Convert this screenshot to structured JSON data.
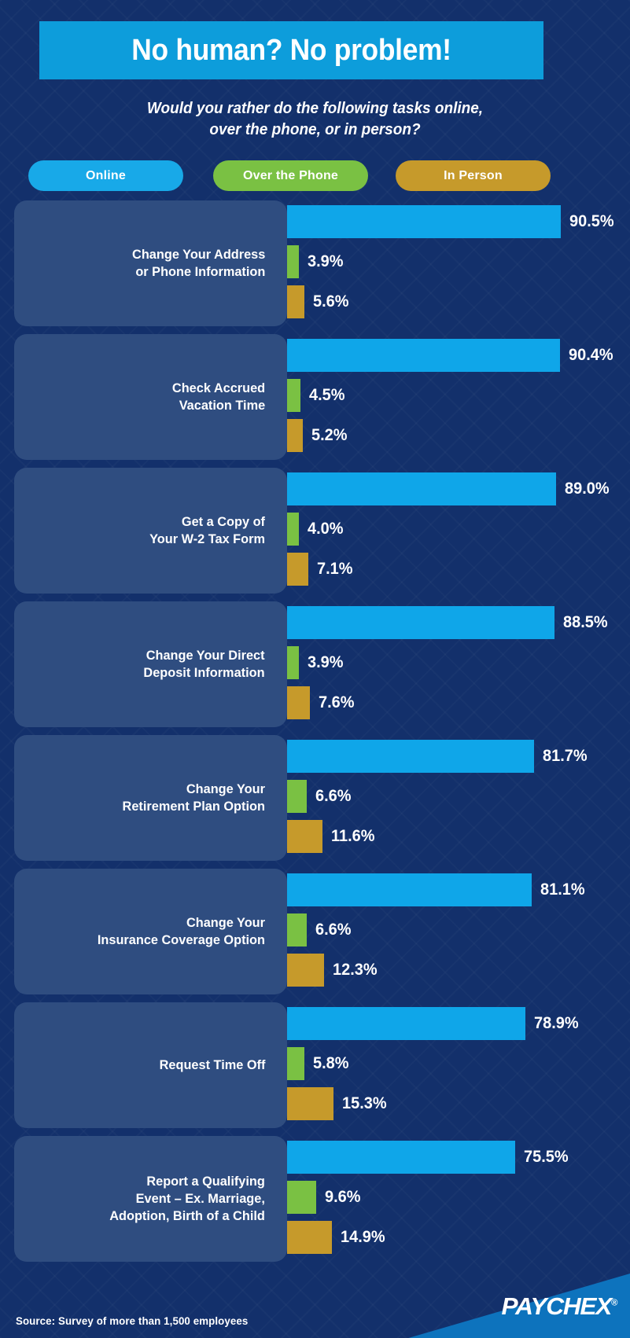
{
  "header": {
    "title": "No human? No problem!",
    "subtitle_line1": "Would you rather do the following tasks online,",
    "subtitle_line2": "over the phone, or in person?"
  },
  "legend": {
    "online": "Online",
    "phone": "Over the Phone",
    "person": "In Person"
  },
  "colors": {
    "background": "#13306b",
    "panel": "#2f4d80",
    "online": "#0fa6e9",
    "phone": "#7ac143",
    "person": "#c69a2b",
    "banner": "#0d9ddb",
    "footer_wedge": "#0d73bd",
    "text": "#ffffff"
  },
  "footer": {
    "source": "Source: Survey of more than 1,500 employees",
    "logo": "PAYCHEX",
    "logo_mark": "®"
  },
  "chart_data": {
    "type": "bar",
    "title": "No human? No problem!",
    "subtitle": "Would you rather do the following tasks online, over the phone, or in person?",
    "orientation": "horizontal",
    "xlabel": "",
    "ylabel": "",
    "xlim": [
      0,
      100
    ],
    "grid": false,
    "legend_position": "top",
    "value_suffix": "%",
    "categories": [
      "Change Your Address or Phone Information",
      "Check Accrued Vacation Time",
      "Get a Copy of Your W-2 Tax Form",
      "Change Your Direct Deposit Information",
      "Change Your Retirement Plan Option",
      "Change Your Insurance Coverage Option",
      "Request Time Off",
      "Report a Qualifying Event – Ex. Marriage, Adoption, Birth of a Child"
    ],
    "series": [
      {
        "name": "Online",
        "color": "#0fa6e9",
        "values": [
          90.5,
          90.4,
          89.0,
          88.5,
          81.7,
          81.1,
          78.9,
          75.5
        ]
      },
      {
        "name": "Over the Phone",
        "color": "#7ac143",
        "values": [
          3.9,
          4.5,
          4.0,
          3.9,
          6.6,
          6.6,
          5.8,
          9.6
        ]
      },
      {
        "name": "In Person",
        "color": "#c69a2b",
        "values": [
          5.6,
          5.2,
          7.1,
          7.6,
          11.6,
          12.3,
          15.3,
          14.9
        ]
      }
    ]
  },
  "rows": [
    {
      "label_lines": [
        "Change Your Address",
        "or Phone Information"
      ],
      "online": "90.5%",
      "phone": "3.9%",
      "person": "5.6%",
      "online_v": 90.5,
      "phone_v": 3.9,
      "person_v": 5.6
    },
    {
      "label_lines": [
        "Check Accrued",
        "Vacation Time"
      ],
      "online": "90.4%",
      "phone": "4.5%",
      "person": "5.2%",
      "online_v": 90.4,
      "phone_v": 4.5,
      "person_v": 5.2
    },
    {
      "label_lines": [
        "Get a Copy of",
        "Your W-2 Tax Form"
      ],
      "online": "89.0%",
      "phone": "4.0%",
      "person": "7.1%",
      "online_v": 89.0,
      "phone_v": 4.0,
      "person_v": 7.1
    },
    {
      "label_lines": [
        "Change Your Direct",
        "Deposit Information"
      ],
      "online": "88.5%",
      "phone": "3.9%",
      "person": "7.6%",
      "online_v": 88.5,
      "phone_v": 3.9,
      "person_v": 7.6
    },
    {
      "label_lines": [
        "Change Your",
        "Retirement Plan Option"
      ],
      "online": "81.7%",
      "phone": "6.6%",
      "person": "11.6%",
      "online_v": 81.7,
      "phone_v": 6.6,
      "person_v": 11.6
    },
    {
      "label_lines": [
        "Change Your",
        "Insurance Coverage Option"
      ],
      "online": "81.1%",
      "phone": "6.6%",
      "person": "12.3%",
      "online_v": 81.1,
      "phone_v": 6.6,
      "person_v": 12.3
    },
    {
      "label_lines": [
        "Request Time Off"
      ],
      "online": "78.9%",
      "phone": "5.8%",
      "person": "15.3%",
      "online_v": 78.9,
      "phone_v": 5.8,
      "person_v": 15.3
    },
    {
      "label_lines": [
        "Report a Qualifying",
        "Event – Ex. Marriage,",
        "Adoption, Birth of a Child"
      ],
      "online": "75.5%",
      "phone": "9.6%",
      "person": "14.9%",
      "online_v": 75.5,
      "phone_v": 9.6,
      "person_v": 14.9
    }
  ]
}
